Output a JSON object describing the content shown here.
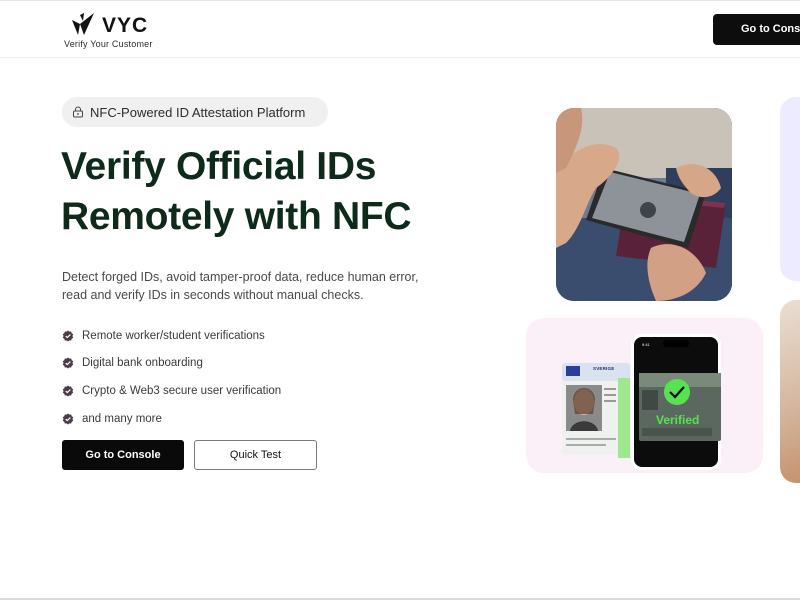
{
  "header": {
    "logo_text": "VYC",
    "logo_tagline": "Verify Your Customer",
    "console_button": "Go to Console"
  },
  "hero": {
    "badge": "NFC-Powered ID Attestation Platform",
    "title_line1": "Verify Official IDs",
    "title_line2": "Remotely with NFC",
    "description_line1": "Detect forged IDs, avoid tamper-proof data, reduce human error,",
    "description_line2": "read and verify IDs in seconds without manual checks.",
    "features": [
      "Remote worker/student verifications",
      "Digital bank onboarding",
      "Crypto & Web3 secure user verification",
      "and many more"
    ],
    "primary_button": "Go to Console",
    "secondary_button": "Quick Test"
  },
  "illustration": {
    "verified_label": "Verified",
    "phone_time": "9:41",
    "license_country": "SVERIGE"
  },
  "colors": {
    "title_green": "#0d2a1a",
    "button_black": "#0a0a0a",
    "check_purple": "#4a3b47",
    "verified_green": "#57e34f",
    "verify_card_bg": "#fbf0f7"
  },
  "icons": {
    "badge": "lock-icon",
    "feature_bullet": "check-badge-icon",
    "verified": "checkmark-circle-icon"
  }
}
